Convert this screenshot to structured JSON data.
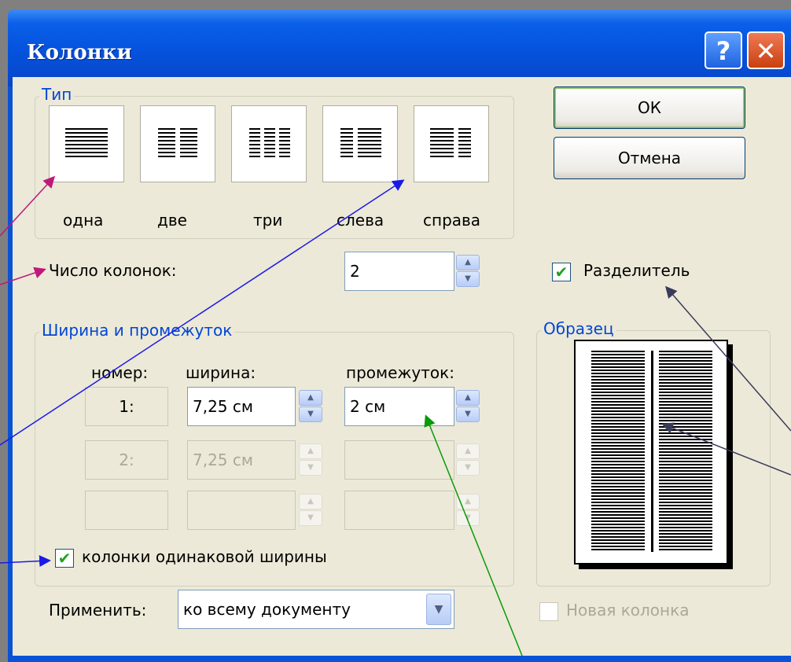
{
  "dialog": {
    "title": "Колонки",
    "help_glyph": "?",
    "close_glyph": "✕"
  },
  "type_group": {
    "legend": "Тип",
    "presets": [
      {
        "label": "одна"
      },
      {
        "label": "две"
      },
      {
        "label": "три"
      },
      {
        "label": "слева"
      },
      {
        "label": "справа"
      }
    ]
  },
  "columns_count": {
    "label": "Число колонок:",
    "value": "2"
  },
  "buttons": {
    "ok": "ОК",
    "cancel": "Отмена"
  },
  "separator": {
    "label": "Разделитель",
    "checked": true
  },
  "width_group": {
    "legend": "Ширина и промежуток",
    "headers": {
      "number": "номер:",
      "width": "ширина:",
      "spacing": "промежуток:"
    },
    "rows": [
      {
        "number": "1:",
        "width": "7,25 см",
        "spacing": "2 см",
        "enabled": true
      },
      {
        "number": "2:",
        "width": "7,25 см",
        "spacing": "",
        "enabled": false
      },
      {
        "number": "",
        "width": "",
        "spacing": "",
        "enabled": false
      }
    ],
    "equal_width": {
      "label": "колонки одинаковой ширины",
      "checked": true
    }
  },
  "sample": {
    "legend": "Образец"
  },
  "apply": {
    "label": "Применить:",
    "value": "ко всему документу"
  },
  "new_column": {
    "label": "Новая колонка",
    "checked": false,
    "enabled": false
  },
  "colors": {
    "pink_arrow": "#c0187a",
    "blue_arrow": "#1a1ae6",
    "green_arrow": "#0a9a0a",
    "gray_arrow": "#3a3a5a"
  }
}
